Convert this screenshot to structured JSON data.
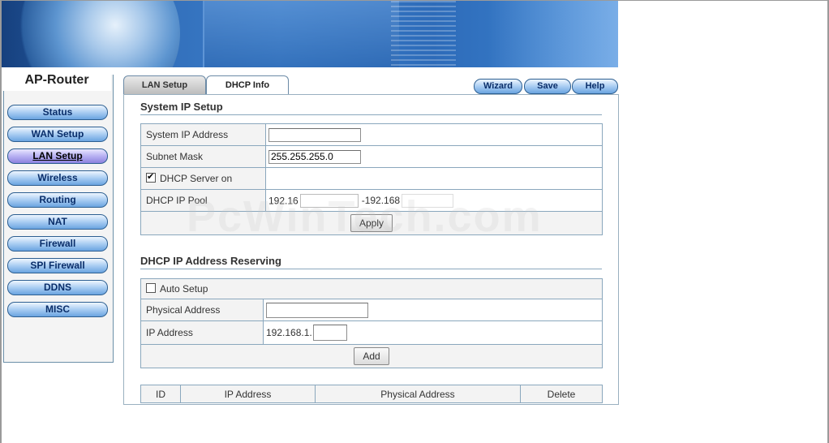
{
  "sidebar": {
    "brand": "AP-Router",
    "items": [
      {
        "label": "Status"
      },
      {
        "label": "WAN Setup"
      },
      {
        "label": "LAN Setup",
        "active": true
      },
      {
        "label": "Wireless"
      },
      {
        "label": "Routing"
      },
      {
        "label": "NAT"
      },
      {
        "label": "Firewall"
      },
      {
        "label": "SPI Firewall"
      },
      {
        "label": "DDNS"
      },
      {
        "label": "MISC"
      }
    ]
  },
  "tabs": [
    {
      "label": "LAN Setup"
    },
    {
      "label": "DHCP Info"
    }
  ],
  "toolbar": {
    "wizard_label": "Wizard",
    "save_label": "Save",
    "help_label": "Help"
  },
  "system_ip": {
    "title": "System IP Setup",
    "ip_label": "System IP Address",
    "ip_value": "",
    "mask_label": "Subnet Mask",
    "mask_value": "255.255.255.0",
    "dhcp_server_label": "DHCP Server on",
    "dhcp_server_checked": true,
    "pool_label": "DHCP IP Pool",
    "pool_start_prefix": "192.16",
    "pool_separator_prefix": "-192.168",
    "apply_label": "Apply"
  },
  "reserving": {
    "title": "DHCP IP Address Reserving",
    "auto_label": "Auto Setup",
    "auto_checked": false,
    "mac_label": "Physical Address",
    "mac_value": "",
    "ip_label": "IP Address",
    "ip_prefix": "192.168.1.",
    "ip_value": "",
    "add_label": "Add"
  },
  "list": {
    "headers": [
      "ID",
      "IP Address",
      "Physical Address",
      "Delete"
    ]
  },
  "watermark": "PcWinTech.com"
}
